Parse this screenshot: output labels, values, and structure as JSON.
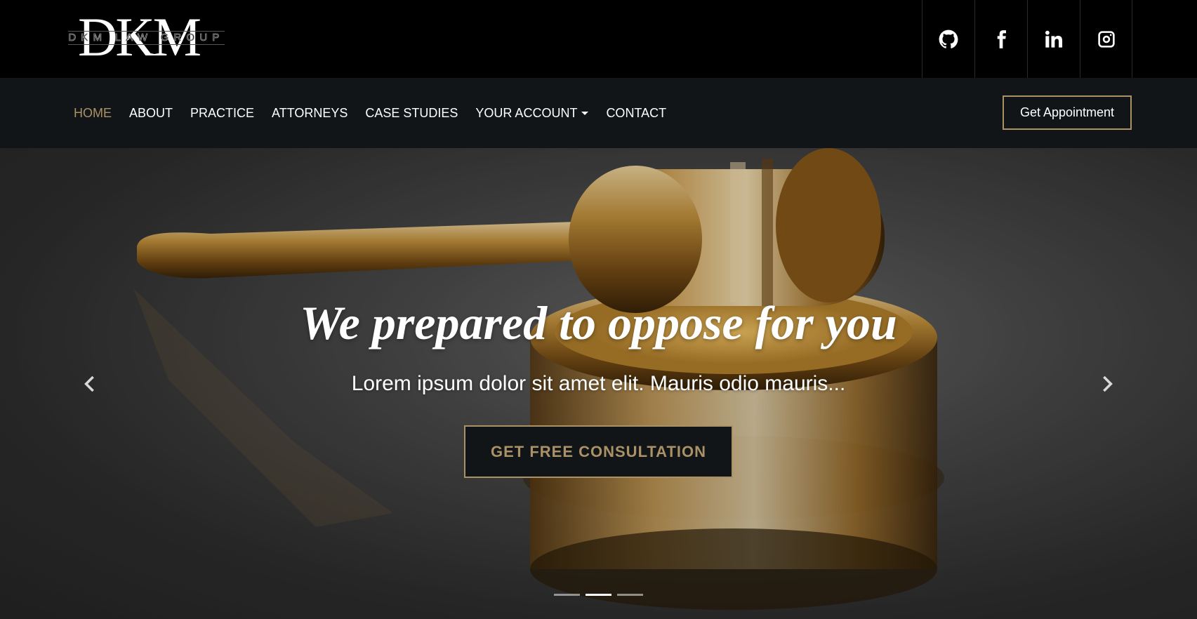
{
  "brand": {
    "logo_text": "DKM",
    "logo_subtext": "DKM LAW GROUP"
  },
  "socials": [
    {
      "name": "github",
      "icon": "github-icon"
    },
    {
      "name": "facebook",
      "icon": "facebook-icon"
    },
    {
      "name": "linkedin",
      "icon": "linkedin-icon"
    },
    {
      "name": "instagram",
      "icon": "instagram-icon"
    }
  ],
  "nav": {
    "items": [
      {
        "label": "HOME",
        "active": true
      },
      {
        "label": "ABOUT"
      },
      {
        "label": "PRACTICE"
      },
      {
        "label": "ATTORNEYS"
      },
      {
        "label": "CASE STUDIES"
      },
      {
        "label": "YOUR ACCOUNT",
        "dropdown": true
      },
      {
        "label": "CONTACT"
      }
    ],
    "cta_label": "Get Appointment"
  },
  "hero": {
    "title": "We prepared to oppose for you",
    "subtitle": "Lorem ipsum dolor sit amet elit. Mauris odio mauris...",
    "button_label": "GET FREE CONSULTATION",
    "slides_count": 3,
    "active_slide": 2,
    "prev_icon": "chevron-left-icon",
    "next_icon": "chevron-right-icon"
  },
  "colors": {
    "accent": "#aa9166",
    "nav_bg": "#121518",
    "top_bg": "#000000"
  }
}
